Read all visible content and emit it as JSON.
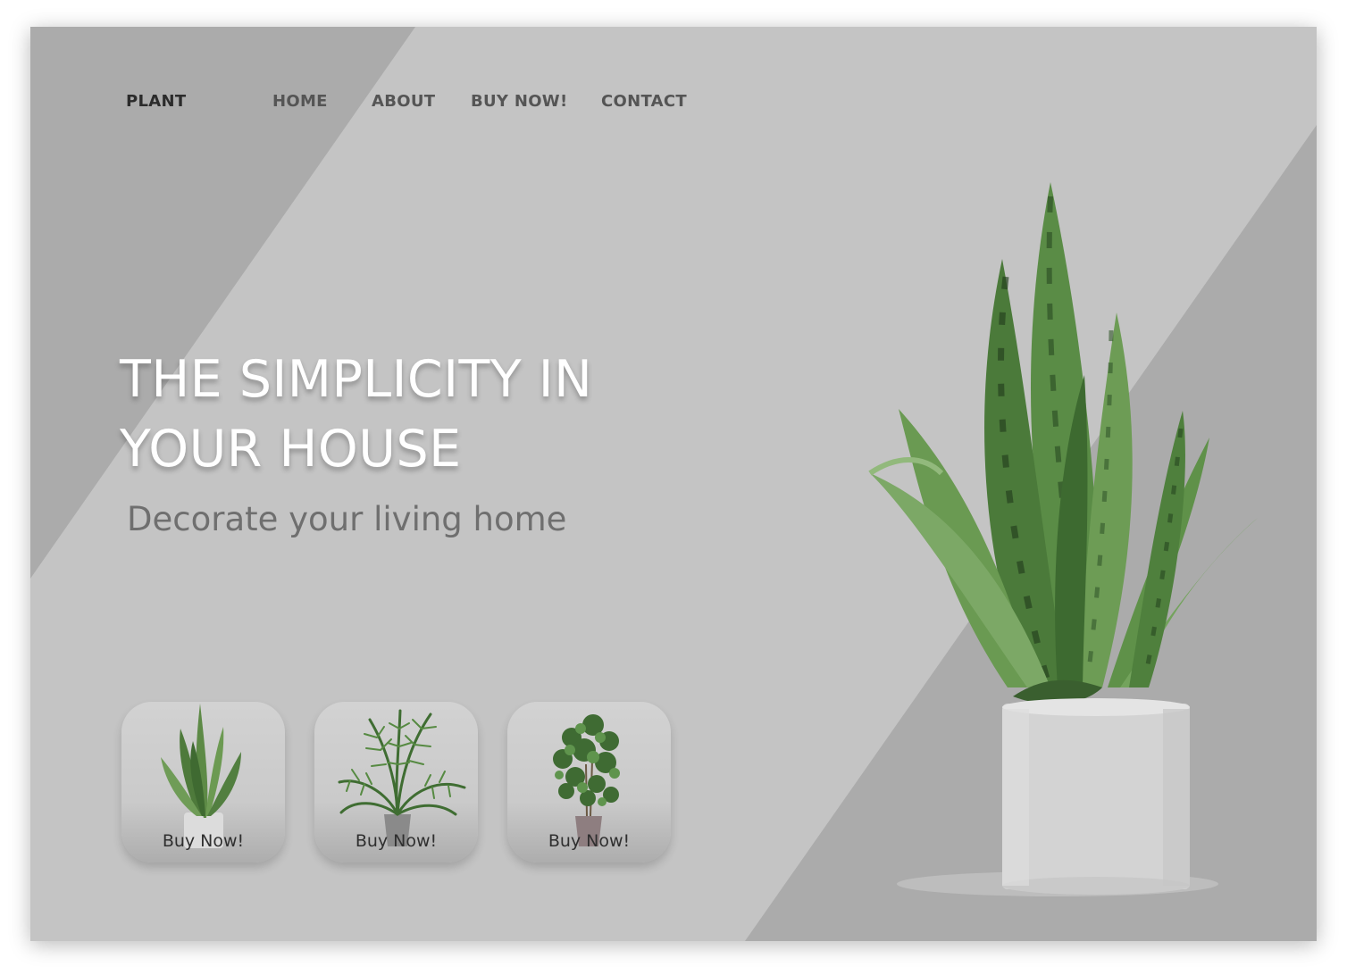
{
  "nav": {
    "brand": "PLANT",
    "links": [
      "HOME",
      "ABOUT",
      "BUY NOW!",
      "CONTACT"
    ]
  },
  "hero": {
    "title_lines": [
      "THE SIMPLICITY IN",
      "YOUR HOUSE"
    ],
    "subtitle": "Decorate your living home"
  },
  "products": [
    {
      "plant": "snake-plant",
      "label": "Buy Now!"
    },
    {
      "plant": "areca-palm",
      "label": "Buy Now!"
    },
    {
      "plant": "ficus-tree",
      "label": "Buy Now!"
    }
  ],
  "colors": {
    "background": "#c4c4c4",
    "diagonal_band": "#ababab",
    "title": "#ffffff",
    "subtitle": "#6f6f6f",
    "plant_green": "#5a8a45",
    "pot": "#d5d5d5"
  }
}
